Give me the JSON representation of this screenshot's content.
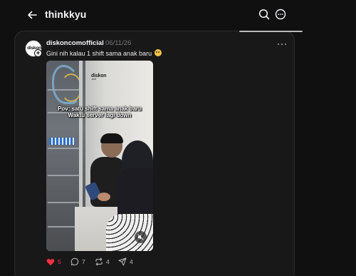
{
  "header": {
    "title": "thinkkyu",
    "back_icon": "arrow-left-icon",
    "search_icon": "search-icon",
    "more_icon": "more-circle-icon"
  },
  "post": {
    "avatar_text": "diskon",
    "username": "diskoncomofficial",
    "date": "06/11/26",
    "caption": "Gini nih kalau 1 shift sama anak baru",
    "caption_emoji": "crying-face-emoji",
    "video": {
      "watermark": "diskon",
      "watermark_sub": ".com",
      "overlay_line1": "Pov: satu shift sama anak baru",
      "overlay_line2": "Waktu server lagi down",
      "muted": true
    },
    "actions": {
      "likes": "5",
      "replies": "7",
      "reposts": "4",
      "shares": "4",
      "liked": true
    }
  },
  "colors": {
    "background": "#101010",
    "card": "#181818",
    "like_active": "#ff3040",
    "text_primary": "#f3f5f7",
    "text_muted": "#777777"
  }
}
